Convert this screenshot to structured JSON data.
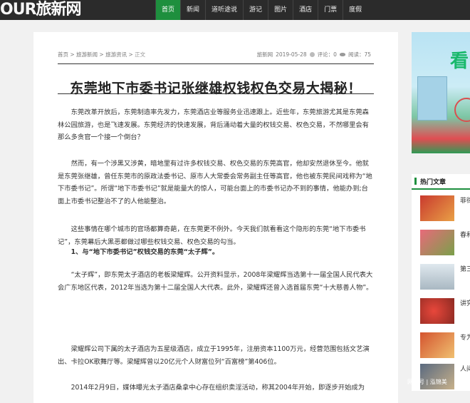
{
  "header": {
    "logo_pre": "OUR",
    "logo_main": "旅新网",
    "nav": [
      "首页",
      "新闻",
      "道听途说",
      "游记",
      "图片",
      "酒店",
      "门票",
      "度假"
    ],
    "active_index": 0,
    "accent": "#1e8f3e"
  },
  "article": {
    "breadcrumb": "首页 > 旅游新闻 > 旅游资讯 > ",
    "breadcrumb_current": "正文",
    "source": "旅新网",
    "date": "2019-05-28",
    "comments": "评论：0",
    "views": "阅读：75",
    "title": "东莞地下市委书记张继雄权钱权色交易大揭秘！",
    "paragraphs": [
      "东莞改革开放后，东莞制造率先发力，东莞酒店业等服务业迅速跟上。近些年，东莞旅游尤其是东莞森林公园旅游，也是飞速发展。东莞经济的快速发展，背后涌动着大量的权钱交易、权色交易，不然哪里会有那么多贪官一个接一个倒台？",
      "然而，有一个涉黑又涉黄，暗地里有过许多权钱交易、权色交易的东莞高官，他却安然退休至今。他就是东莞张继雄，曾任东莞市的原政法委书记、原市人大常委会常务副主任等高官，他也被东莞民间戏称为“地下市委书记”。所谓“地下市委书记”就是能量大的惊人，可能台面上的市委书记办不到的事情，他能办到;台面上市委书记整治不了的人他能整治。",
      "这些事情在哪个城市的官场都算奇葩，在东莞更不例外。今天我们就看看这个隐形的东莞“地下市委书记”，东莞幕后大黑恶都做过哪些权钱交易、权色交易的勾当。",
      "1、与“地下市委书记”权钱交易的东莞“太子辉”。",
      "“太子辉”，即东莞太子酒店的老板梁耀辉。公开资料显示，2008年梁耀辉当选第十一届全国人民代表大会广东地区代表，2012年当选为第十二届全国人大代表。此外，梁耀辉还曾入选首届东莞“十大慈善人物”。",
      "梁耀辉公司下属的太子酒店为五星级酒店，成立于1995年，注册资本1100万元，经营范围包括文艺演出、卡拉OK歌舞厅等。梁耀辉曾以20亿元个人财富位列“百富榜”第406位。",
      "2014年2月9日，媒体曝光太子酒店桑拿中心存在组织卖淫活动，称其2004年开始，即逐步开始成为"
    ]
  },
  "sidebar": {
    "banner_text": "看",
    "hot_title": "热门文章",
    "hot_items": [
      "菲律宾销量",
      "春和光：",
      "第三推介",
      "讲究精致",
      "专为爆品",
      "人间"
    ]
  },
  "watermark": "网易号 | 泓锦美"
}
